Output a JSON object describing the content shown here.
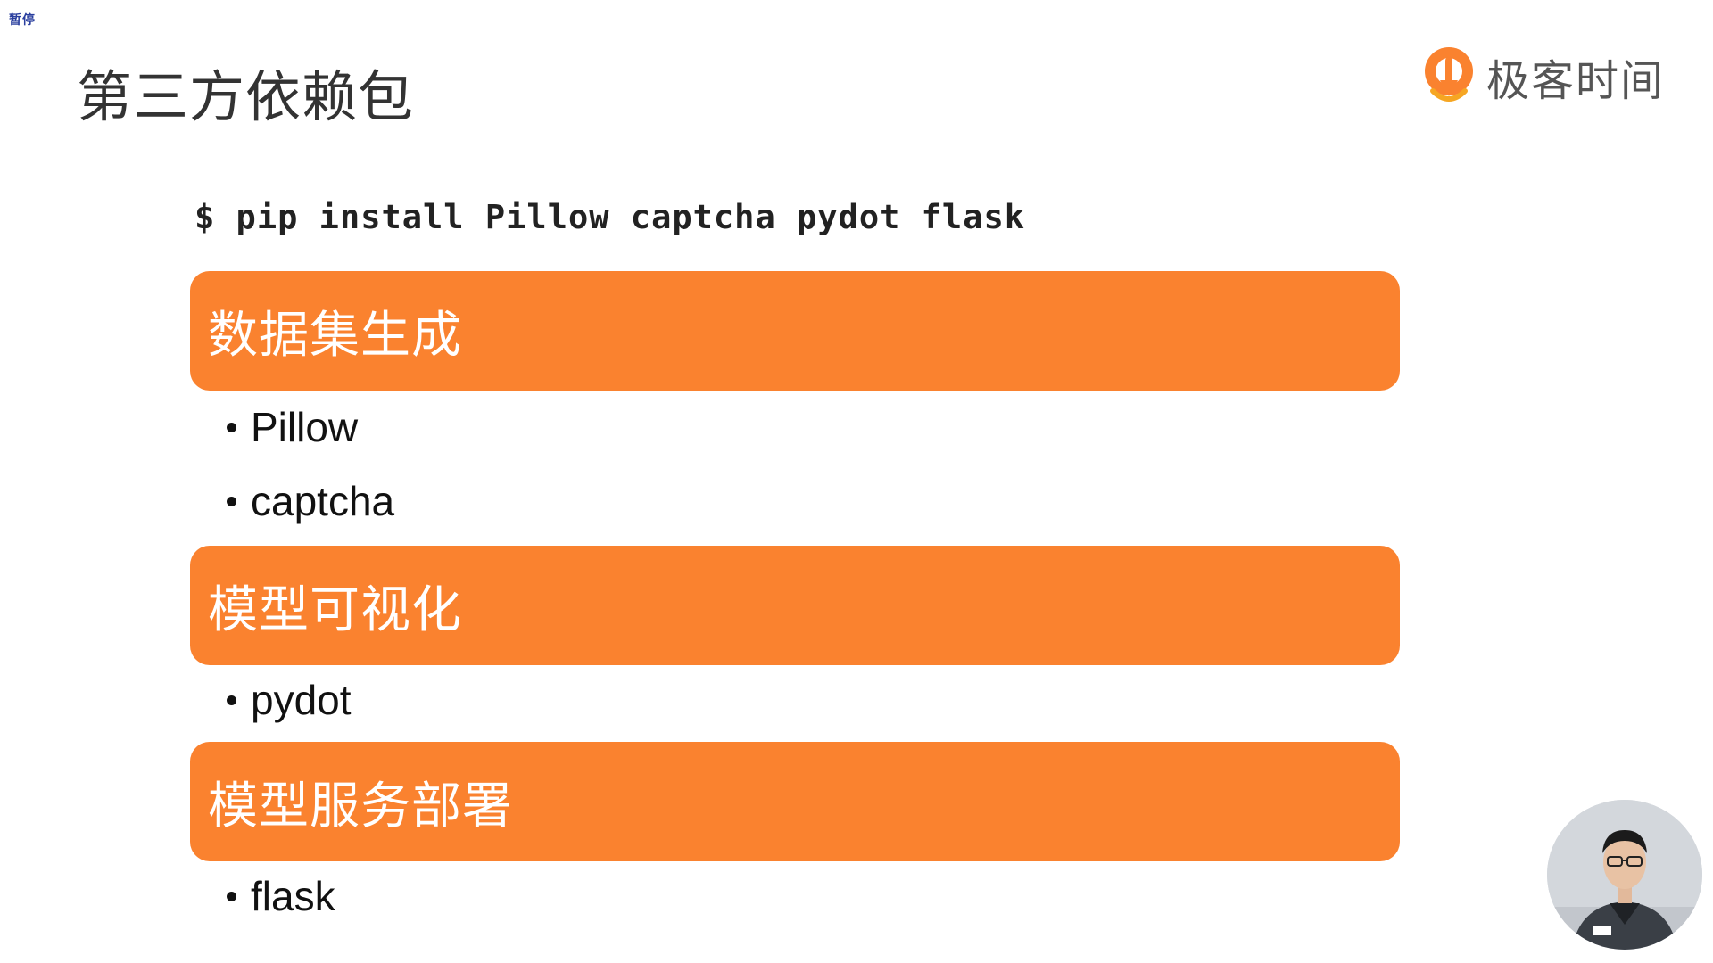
{
  "overlay": {
    "pause_label": "暂停"
  },
  "slide": {
    "title": "第三方依赖包",
    "brand": {
      "name": "极客时间",
      "logo_icon": "geektime-logo-icon",
      "color": "#fa822f"
    },
    "command": "$ pip install Pillow captcha pydot flask",
    "sections": [
      {
        "header": "数据集生成",
        "items": [
          "Pillow",
          "captcha"
        ]
      },
      {
        "header": "模型可视化",
        "items": [
          "pydot"
        ]
      },
      {
        "header": "模型服务部署",
        "items": [
          "flask"
        ]
      }
    ],
    "colors": {
      "accent": "#fa822f",
      "title_text": "#333333",
      "body_text": "#111111"
    }
  },
  "presenter": {
    "icon": "presenter-video-icon"
  }
}
